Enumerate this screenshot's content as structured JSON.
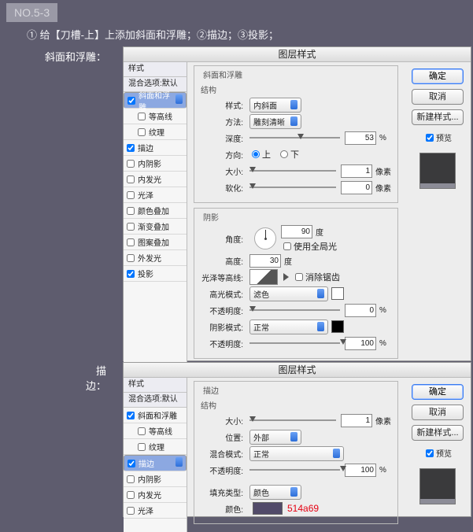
{
  "tag": "NO.5-3",
  "header": "① 给【刀槽-上】上添加斜面和浮雕；②描边；③投影；",
  "label_bevel": "斜面和浮雕：",
  "label_stroke": "描边：",
  "dlg_title": "图层样式",
  "buttons": {
    "ok": "确定",
    "cancel": "取消",
    "newstyle": "新建样式...",
    "preview": "预览"
  },
  "sidebar": {
    "h1": "样式",
    "h2": "混合选项:默认",
    "items": [
      "斜面和浮雕",
      "等高线",
      "纹理",
      "描边",
      "内阴影",
      "内发光",
      "光泽",
      "颜色叠加",
      "渐变叠加",
      "图案叠加",
      "外发光",
      "投影"
    ]
  },
  "bevel": {
    "group_main": "斜面和浮雕",
    "group_struct": "结构",
    "l_style": "样式:",
    "v_style": "内斜面",
    "l_tech": "方法:",
    "v_tech": "雕刻清晰",
    "l_depth": "深度:",
    "v_depth": "53",
    "u_pct": "%",
    "l_dir": "方向:",
    "r_up": "上",
    "r_down": "下",
    "l_size": "大小:",
    "v_size": "1",
    "u_px": "像素",
    "l_soft": "软化:",
    "v_soft": "0",
    "group_shade": "阴影",
    "l_angle": "角度:",
    "v_angle": "90",
    "u_deg": "度",
    "l_global": "使用全局光",
    "l_alt": "高度:",
    "v_alt": "30",
    "l_gloss": "光泽等高线:",
    "l_aa": "消除锯齿",
    "l_hmode": "高光模式:",
    "v_hmode": "滤色",
    "l_op": "不透明度:",
    "v_hop": "0",
    "l_smode": "阴影模式:",
    "v_smode": "正常",
    "v_sop": "100"
  },
  "stroke": {
    "group": "描边",
    "group_struct": "结构",
    "l_size": "大小:",
    "v_size": "1",
    "u_px": "像素",
    "l_pos": "位置:",
    "v_pos": "外部",
    "l_blend": "混合模式:",
    "v_blend": "正常",
    "l_op": "不透明度:",
    "v_op": "100",
    "u_pct": "%",
    "l_fill": "填充类型:",
    "v_fill": "颜色",
    "l_color": "颜色:",
    "hex": "514a69"
  },
  "chart_data": null
}
